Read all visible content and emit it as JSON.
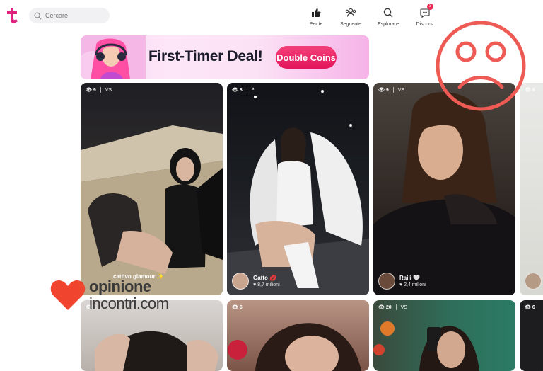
{
  "header": {
    "search": {
      "placeholder": "Cercare"
    },
    "nav": [
      {
        "label": "Per te",
        "icon": "thumbs-up-icon"
      },
      {
        "label": "Seguente",
        "icon": "people-icon"
      },
      {
        "label": "Esplorare",
        "icon": "search-icon"
      },
      {
        "label": "Discorsi",
        "icon": "chat-icon",
        "badge": "3"
      }
    ]
  },
  "banner": {
    "title": "First-Timer Deal!",
    "cta": "Double Coins"
  },
  "cards": [
    {
      "views": "9",
      "vs": "VS",
      "name": "cattivo glamour ✨",
      "likes": ""
    },
    {
      "views": "8",
      "vs": "",
      "name": "Gatto 💋",
      "likes": "8,7 milioni"
    },
    {
      "views": "9",
      "vs": "VS",
      "name": "Raili 🤍",
      "likes": "2,4 milioni"
    },
    {
      "views": "6",
      "vs": "",
      "name": "",
      "likes": ""
    },
    {
      "views": "6",
      "vs": "",
      "name": "",
      "likes": ""
    },
    {
      "views": "6",
      "vs": "",
      "name": "",
      "likes": ""
    },
    {
      "views": "20",
      "vs": "VS",
      "name": "",
      "likes": ""
    },
    {
      "views": "6",
      "vs": "",
      "name": "",
      "likes": ""
    }
  ],
  "watermark": {
    "line1": "opinione",
    "line2": "incontri.com"
  },
  "colors": {
    "brand": "#e0217d",
    "accent": "#ec2a55",
    "sad_face": "#ee5b55"
  }
}
